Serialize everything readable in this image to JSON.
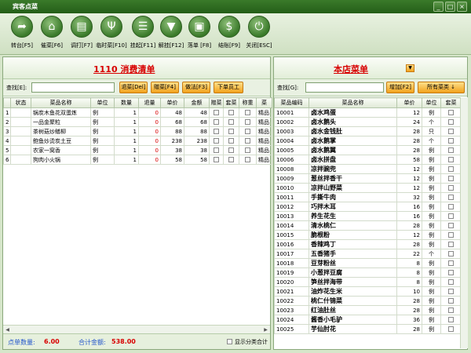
{
  "window": {
    "title": "宾客点菜",
    "btn_min": "_",
    "btn_max": "□",
    "btn_close": "×"
  },
  "toolbar": [
    {
      "icon": "arrow-icon",
      "glyph": "➦",
      "label": "转台[F5]"
    },
    {
      "icon": "bank-icon",
      "glyph": "⌂",
      "label": "催菜[F6]"
    },
    {
      "icon": "document-icon",
      "glyph": "▤",
      "label": "调打[F7]"
    },
    {
      "icon": "utensils-icon",
      "glyph": "Ψ",
      "label": "临时菜[F10]"
    },
    {
      "icon": "tray-icon",
      "glyph": "☰",
      "label": "挂起[F11]"
    },
    {
      "icon": "tie-icon",
      "glyph": "▼",
      "label": "解挂[F12]"
    },
    {
      "icon": "menu-card-icon",
      "glyph": "▣",
      "label": "落单 [F8]"
    },
    {
      "icon": "dollar-icon",
      "glyph": "$",
      "label": "结账[F9]"
    },
    {
      "icon": "power-icon",
      "glyph": "⏻",
      "label": "关闭[ESC]"
    }
  ],
  "left": {
    "title": "1110 消费清单",
    "find_label": "查找[E]:",
    "find_value": "",
    "buttons": [
      "退菜[Del]",
      "赠菜[F4]",
      "做法[F3]",
      "下单员工"
    ],
    "columns": [
      "",
      "状态",
      "菜品名称",
      "单位",
      "数量",
      "退量",
      "单价",
      "金额",
      "赠菜",
      "套菜",
      "称重",
      "菜"
    ],
    "rows": [
      {
        "no": "1",
        "status": "",
        "name": "锅炭木鱼花双蛋炼",
        "unit": "例",
        "qty": "1",
        "ret": "0",
        "price": "48",
        "amount": "48",
        "extra": "精品"
      },
      {
        "no": "2",
        "status": "",
        "name": "一品金聚粒",
        "unit": "例",
        "qty": "1",
        "ret": "0",
        "price": "68",
        "amount": "68",
        "extra": "精品"
      },
      {
        "no": "3",
        "status": "",
        "name": "茶树菇炒鳝柳",
        "unit": "例",
        "qty": "1",
        "ret": "0",
        "price": "88",
        "amount": "88",
        "extra": "精品"
      },
      {
        "no": "4",
        "status": "",
        "name": "鲍鱼炒烫炭土豆",
        "unit": "例",
        "qty": "1",
        "ret": "0",
        "price": "238",
        "amount": "238",
        "extra": "精品"
      },
      {
        "no": "5",
        "status": "",
        "name": "农家一窝香",
        "unit": "例",
        "qty": "1",
        "ret": "0",
        "price": "38",
        "amount": "38",
        "extra": "精品"
      },
      {
        "no": "6",
        "status": "",
        "name": "狗肉小火锅",
        "unit": "例",
        "qty": "1",
        "ret": "0",
        "price": "58",
        "amount": "58",
        "extra": "精品"
      }
    ],
    "footer": {
      "count_label": "点单数量:",
      "count_value": "6.00",
      "total_label": "合计金额:",
      "total_value": "538.00",
      "show_label": "显示分类合计"
    }
  },
  "right": {
    "title": "本店菜单",
    "find_label": "查找[G]:",
    "find_value": "",
    "add_button": "增加[F2]",
    "category_button": "所有菜类 ↓",
    "columns": [
      "菜品编码",
      "菜品名称",
      "单价",
      "单位",
      "套菜"
    ],
    "rows": [
      {
        "code": "10001",
        "name": "卤水鸡蛋",
        "price": "12",
        "unit": "例"
      },
      {
        "code": "10002",
        "name": "卤水鹅头",
        "price": "24",
        "unit": "个"
      },
      {
        "code": "10003",
        "name": "卤水金钱肚",
        "price": "28",
        "unit": "只"
      },
      {
        "code": "10004",
        "name": "卤水鹅掌",
        "price": "28",
        "unit": "个"
      },
      {
        "code": "10005",
        "name": "卤水鹅翼",
        "price": "28",
        "unit": "例"
      },
      {
        "code": "10006",
        "name": "卤水拼盘",
        "price": "58",
        "unit": "例"
      },
      {
        "code": "10008",
        "name": "凉拌豌兜",
        "price": "12",
        "unit": "例"
      },
      {
        "code": "10009",
        "name": "葱丝拌香干",
        "price": "12",
        "unit": "例"
      },
      {
        "code": "10010",
        "name": "凉拌山野菜",
        "price": "12",
        "unit": "例"
      },
      {
        "code": "10011",
        "name": "手撕牛肉",
        "price": "32",
        "unit": "例"
      },
      {
        "code": "10012",
        "name": "巧拌木耳",
        "price": "16",
        "unit": "例"
      },
      {
        "code": "10013",
        "name": "养生花生",
        "price": "16",
        "unit": "例"
      },
      {
        "code": "10014",
        "name": "清水桃仁",
        "price": "28",
        "unit": "例"
      },
      {
        "code": "10015",
        "name": "脆根粉",
        "price": "12",
        "unit": "例"
      },
      {
        "code": "10016",
        "name": "香辣鸡丁",
        "price": "28",
        "unit": "例"
      },
      {
        "code": "10017",
        "name": "五香猪手",
        "price": "22",
        "unit": "个"
      },
      {
        "code": "10018",
        "name": "豆芽粉丝",
        "price": "8",
        "unit": "例"
      },
      {
        "code": "10019",
        "name": "小葱拌豆腐",
        "price": "8",
        "unit": "例"
      },
      {
        "code": "10020",
        "name": "笋丝拌海带",
        "price": "8",
        "unit": "例"
      },
      {
        "code": "10021",
        "name": "油炸花生米",
        "price": "10",
        "unit": "例"
      },
      {
        "code": "10022",
        "name": "桃仁什锦菜",
        "price": "28",
        "unit": "例"
      },
      {
        "code": "10023",
        "name": "红油肚丝",
        "price": "28",
        "unit": "例"
      },
      {
        "code": "10024",
        "name": "酱香小毛驴",
        "price": "36",
        "unit": "例"
      },
      {
        "code": "10025",
        "name": "芋仙肘花",
        "price": "28",
        "unit": "例"
      }
    ]
  }
}
